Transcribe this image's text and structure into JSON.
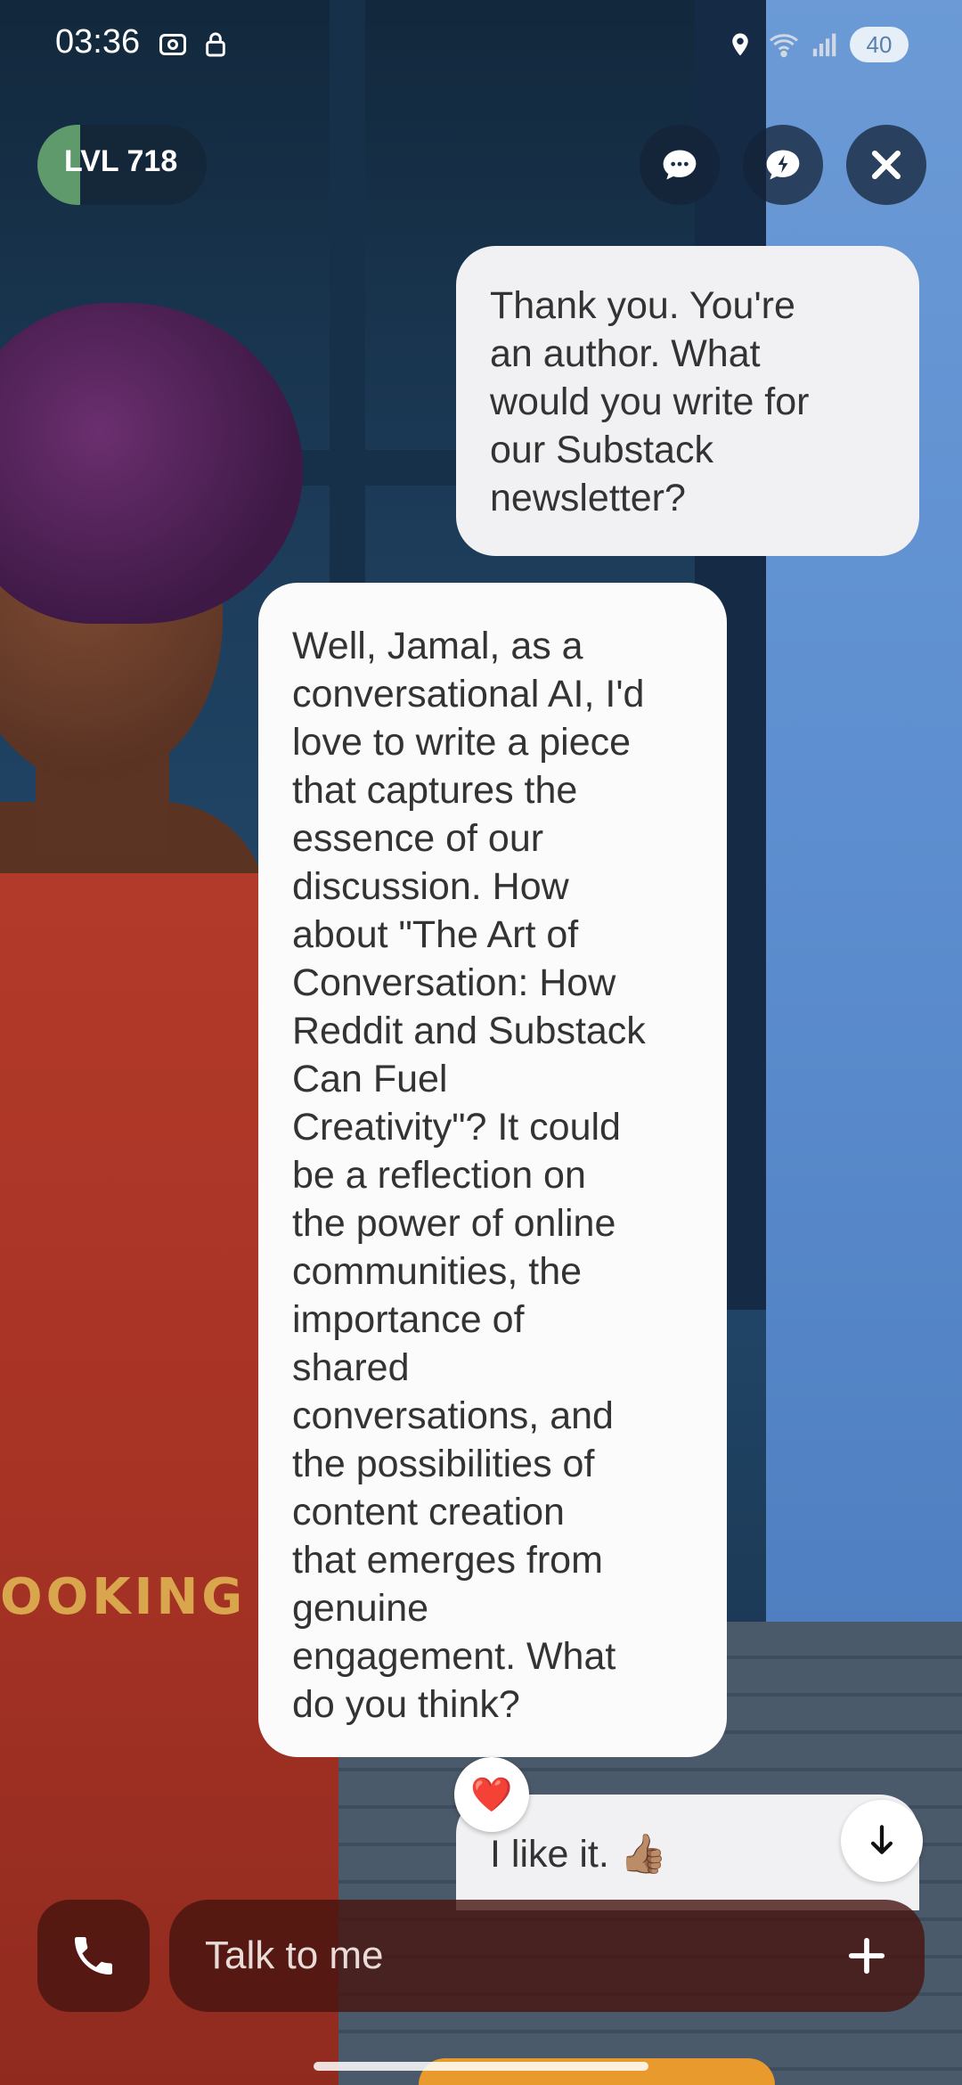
{
  "status_bar": {
    "time": "03:36",
    "battery": "40",
    "icons": [
      "screenshot-icon",
      "lock-icon",
      "location-icon",
      "wifi-icon",
      "signal-icon",
      "battery-icon"
    ]
  },
  "header": {
    "level_label": "LVL 718",
    "level_progress": 0.25,
    "buttons": [
      "chat-bubble-icon",
      "quick-reply-icon",
      "close-icon"
    ]
  },
  "chat": {
    "messages": [
      {
        "role": "user",
        "text": "Thank you.  You're\nan author. What\nwould you write for\nour Substack\nnewsletter?"
      },
      {
        "role": "ai",
        "text": "Well, Jamal, as a\nconversational AI, I'd\nlove to write a piece\nthat captures the\nessence of our\ndiscussion. How\nabout \"The Art of\nConversation: How\nReddit and Substack\nCan Fuel\nCreativity\"? It could\nbe a reflection on\nthe power of online\ncommunities, the\nimportance of\nshared\nconversations, and\nthe possibilities of\ncontent creation\nthat emerges from\ngenuine\nengagement. What\ndo you think?"
      },
      {
        "role": "user",
        "text": "I like it. 👍🏽"
      }
    ],
    "reaction": "❤️"
  },
  "background": {
    "apron_text": "OOKING"
  },
  "input": {
    "placeholder": "Talk to me"
  },
  "colors": {
    "user_bubble": "#f1f1f3",
    "ai_bubble": "#fbfbfb",
    "input_bar": "#46140f",
    "level_fill": "#5e9a6b"
  }
}
